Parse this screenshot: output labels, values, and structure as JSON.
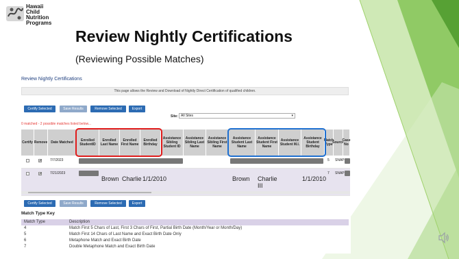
{
  "slide": {
    "logo": [
      "Hawaii",
      "Child",
      "Nutrition",
      "Programs"
    ],
    "title": "Review Nightly Certifications",
    "subtitle": "(Reviewing Possible Matches)"
  },
  "page": {
    "title": "Review Nightly Certifications",
    "info": "This page allows the Review and Download of Nightly Direct Certification of qualified children.",
    "buttons": [
      "Certify Selected",
      "Save Results",
      "Remove Selected",
      "Export"
    ],
    "site_label": "Site:",
    "site_value": "All Sites",
    "matched_note": "0 matched - 2 possible matches listed below..."
  },
  "table": {
    "headers": [
      "Certify",
      "Remove",
      "Date Matched",
      "Enrolled StudentID",
      "Enrolled Last Name",
      "Enrolled First Name",
      "Enrolled Birthday",
      "Assistance Sibling Student ID",
      "Assistance Sibling Last Name",
      "Assistance Sibling First Name",
      "Assistance Student Last Name",
      "Assistance Student First Name",
      "Assistance Student M.I.",
      "Assistance Student Birthday",
      "Match Type",
      "Source",
      "Case No"
    ],
    "rows": [
      {
        "certify": "",
        "remove": "✔",
        "date": "7/7/2023",
        "enrolled_last": "",
        "enrolled_first": "",
        "enrolled_birthday": "",
        "assist_last": "",
        "assist_first": "",
        "assist_birthday": "",
        "match_type": "5",
        "source": "SNAP"
      },
      {
        "certify": "",
        "remove": "✔",
        "date": "7/21/2023",
        "enrolled_last": "Brown",
        "enrolled_first": "Charlie",
        "enrolled_birthday": "1/1/2010",
        "assist_last": "Brown",
        "assist_first": "Charlie III",
        "assist_birthday": "1/1/2010",
        "match_type": "7",
        "source": "SNAP"
      }
    ]
  },
  "match_key": {
    "title": "Match Type Key",
    "col_type": "Match Type",
    "col_desc": "Description",
    "rows": [
      {
        "type": "4",
        "desc": "Match First 5 Chars of Last, First 3 Chars of First, Partial Birth Date (Month/Year or Month/Day)"
      },
      {
        "type": "5",
        "desc": "Match First 14 Chars of Last Name and Exact Birth Date Only"
      },
      {
        "type": "6",
        "desc": "Metaphone Match and Exact Birth Date"
      },
      {
        "type": "7",
        "desc": "Double Metaphone Match and Exact Birth Date"
      }
    ]
  },
  "colors": {
    "highlight_enrolled": "#e01b1b",
    "highlight_assistance": "#1d6fd1",
    "deco_green": "#7cc242",
    "button_blue": "#2c6bb3"
  },
  "icons": {
    "logo": "hawaii-cnp-logo-icon",
    "speaker": "speaker-icon"
  }
}
